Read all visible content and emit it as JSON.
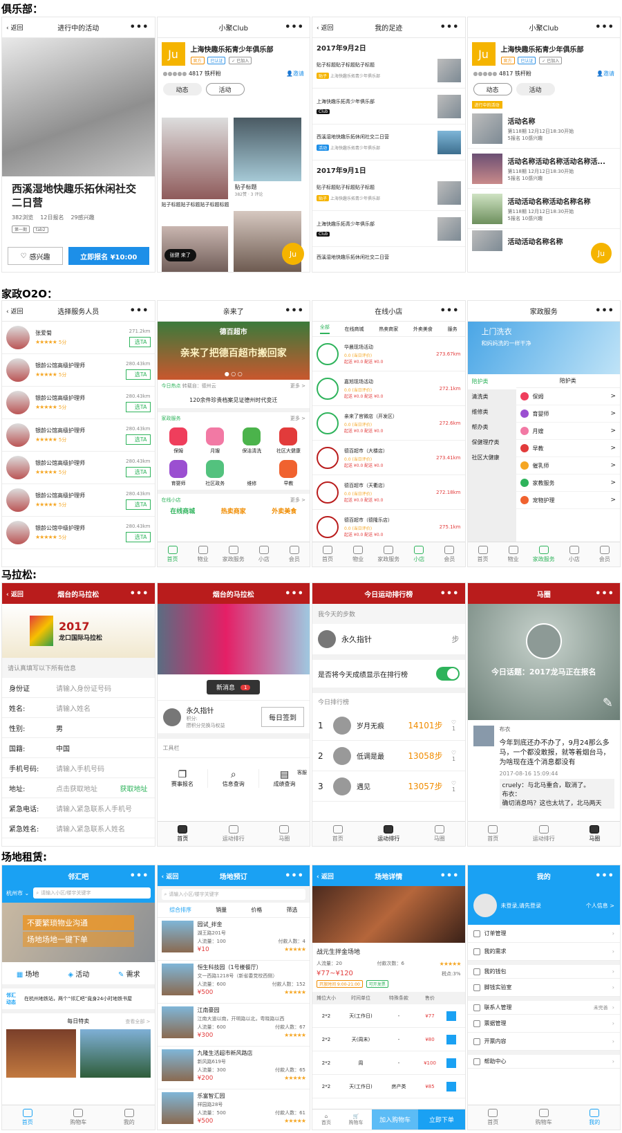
{
  "sections": {
    "club": "俱乐部：",
    "home": "家政O2O：",
    "marathon": "马拉松:",
    "venue": "场地租赁:"
  },
  "club": {
    "s1": {
      "back": "返回",
      "title": "进行中的活动",
      "more": "•••",
      "event_title": "西溪湿地快趣乐拓休闲社交二日营",
      "stats": [
        "382浏览",
        "12日报名",
        "29感兴趣"
      ],
      "tags": [
        "第一期",
        "tab2"
      ],
      "interest": "感兴趣",
      "signup": "立即报名 ¥10:00"
    },
    "s2": {
      "title": "小聚Club",
      "more": "•••",
      "logo": "Ju",
      "club_name": "上海快趣乐拓青少年俱乐部",
      "badges": [
        "官方",
        "已认证",
        "✓ 已加入"
      ],
      "fans": "4817 铁杆粉",
      "invite": "邀请",
      "tabs": [
        "动态",
        "活动"
      ],
      "post_caption": "贴子标题贴子标题贴子标题标题",
      "post2_title": "贴子标题",
      "post2_stats": "382赞 · 3 评论",
      "user": "张健 来了",
      "fab": "Ju"
    },
    "s3": {
      "back": "返回",
      "title": "我的足迹",
      "more": "•••",
      "date1": "2017年9月2日",
      "date2": "2017年9月1日",
      "items": [
        {
          "title": "贴子标题贴子标题贴子标题",
          "badge": "贴子",
          "sub": "上海快趣乐拓青少年俱乐部"
        },
        {
          "title": "上海快趣乐拓青少年俱乐部",
          "badge": "Club",
          "sub": ""
        },
        {
          "title": "西溪湿地快趣乐拓休闲社交二日营",
          "badge": "活动",
          "sub": "上海快趣乐拓青少年俱乐部"
        },
        {
          "title": "贴子标题贴子标题贴子标题",
          "badge": "贴子",
          "sub": "上海快趣乐拓青少年俱乐部"
        },
        {
          "title": "上海快趣乐拓青少年俱乐部",
          "badge": "Club",
          "sub": ""
        },
        {
          "title": "西溪湿地快趣乐拓休闲社交二日营",
          "badge": "",
          "sub": ""
        }
      ]
    },
    "s4": {
      "title": "小聚Club",
      "more": "•••",
      "logo": "Ju",
      "club_name": "上海快趣乐拓青少年俱乐部",
      "badges": [
        "官方",
        "已认证",
        "✓ 已加入"
      ],
      "fans": "4817 铁杆粉",
      "invite": "邀请",
      "tabs": [
        "动态",
        "活动"
      ],
      "section_badge": "进行中的活动",
      "items": [
        {
          "title": "活动名称",
          "line1": "第118期 12月12日18:30开始",
          "line2": "5报名 10感兴趣"
        },
        {
          "title": "活动名称活动名称活动名称活...",
          "line1": "第118期 12月12日18:30开始",
          "line2": "5报名 10感兴趣"
        },
        {
          "title": "活动活动名称活动名称名称",
          "line1": "第118期 12月12日18:30开始",
          "line2": "5报名 10感兴趣"
        },
        {
          "title": "活动活动名称名称",
          "line1": "",
          "line2": ""
        }
      ],
      "fab": "Ju"
    }
  },
  "home": {
    "s1": {
      "back": "返回",
      "title": "选择服务人员",
      "more": "•••",
      "pick": "选TA",
      "stars": "★★★★★",
      "people": [
        {
          "name": "张爱菊",
          "dist": "271.2km",
          "score": "5分"
        },
        {
          "name": "银龄公馆高级护理师",
          "dist": "280.43km",
          "score": "5分"
        },
        {
          "name": "银龄公馆高级护理师",
          "dist": "280.43km",
          "score": "5分"
        },
        {
          "name": "银龄公馆高级护理师",
          "dist": "280.43km",
          "score": "5分"
        },
        {
          "name": "银龄公馆高级护理师",
          "dist": "280.43km",
          "score": "5分"
        },
        {
          "name": "银龄公馆高级护理师",
          "dist": "280.43km",
          "score": "5分"
        },
        {
          "name": "银龄公馆中级护理师",
          "dist": "280.43km",
          "score": "5分"
        }
      ]
    },
    "s2": {
      "title": "亲来了",
      "more": "•••",
      "banner_brand": "德百超市",
      "banner_text": "亲来了把德百超市搬回家",
      "hot_label": "今日热点",
      "hot_sub": "转载自：德州云",
      "more_link": "更多 >",
      "hot_text": "120余件珍贵档案见证德州时代变迁",
      "svc_label": "家政服务",
      "services": [
        "保姆",
        "月嫂",
        "保洁清洗",
        "社区大健康",
        "育婴师",
        "社区政务",
        "维修",
        "早教"
      ],
      "shop_label": "在线小店",
      "shop_row": [
        "在线商城",
        "热卖商家",
        "外卖美食"
      ]
    },
    "s3": {
      "title": "在线小店",
      "more": "•••",
      "tabs": [
        "全部",
        "在线商城",
        "热卖商家",
        "外卖美食",
        "服务"
      ],
      "shops": [
        {
          "name": "华晨现场活动",
          "dist": "273.67km"
        },
        {
          "name": "嘉旭现场活动",
          "dist": "272.1km"
        },
        {
          "name": "亲来了官微店（开发区）",
          "dist": "272.6km"
        },
        {
          "name": "德百超市（大楼店）",
          "dist": "273.41km"
        },
        {
          "name": "德百超市（天衢店）",
          "dist": "272.18km"
        },
        {
          "name": "德百超市（德隆乐店）",
          "dist": "275.1km"
        }
      ],
      "shop_line1": "0.0 (当日评价)",
      "shop_line2": "起送 ¥0.0 配送 ¥0.0"
    },
    "s4": {
      "title": "家政服务",
      "more": "•••",
      "banner1": "上门洗衣",
      "banner2": "和妈妈洗的一样干净",
      "side": [
        "陪护类",
        "清洗类",
        "维修类",
        "帮办类",
        "保健理疗类",
        "社区大健康"
      ],
      "header": "陪护类",
      "items": [
        "保姆",
        "育婴师",
        "月嫂",
        "早教",
        "催乳师",
        "家教服务",
        "宠物护理"
      ]
    },
    "tabs": [
      "首页",
      "物业",
      "家政服务",
      "小店",
      "会员"
    ]
  },
  "marathon": {
    "s1": {
      "back": "返回",
      "title": "烟台的马拉松",
      "more": "•••",
      "banner_year": "2017",
      "banner_name": "龙口国际马拉松",
      "hint": "请认真填写以下所有信息",
      "fields": [
        {
          "label": "身份证",
          "value": "请输入身份证号码"
        },
        {
          "label": "姓名:",
          "value": "请输入姓名"
        },
        {
          "label": "性别:",
          "value": "男"
        },
        {
          "label": "国籍:",
          "value": "中国"
        },
        {
          "label": "手机号码:",
          "value": "请输入手机号码"
        },
        {
          "label": "地址:",
          "value": "点击获取地址"
        },
        {
          "label": "紧急电话:",
          "value": "请输入紧急联系人手机号"
        },
        {
          "label": "紧急姓名:",
          "value": "请输入紧急联系人姓名"
        }
      ],
      "get_addr": "获取地址"
    },
    "s2": {
      "title": "烟台的马拉松",
      "more": "•••",
      "news": "新消息",
      "news_count": "1",
      "user": "永久指针",
      "points": "积分:",
      "points_sub": "攒积分兑换马权益",
      "checkin": "每日签到",
      "tools_label": "工具栏",
      "tools": [
        "赛事报名",
        "信息查询",
        "成绩查询"
      ],
      "service": "客服",
      "tabs": [
        "首页",
        "运动排行",
        "马圈"
      ]
    },
    "s3": {
      "title": "今日运动排行榜",
      "more": "•••",
      "steps_label": "我今天的步数",
      "user": "永久指针",
      "step_unit": "步",
      "toggle_label": "是否将今天成绩显示在排行榜",
      "rank_label": "今日排行榜",
      "ranks": [
        {
          "n": "1",
          "name": "岁月无痕",
          "steps": "14101步",
          "likes": "1"
        },
        {
          "n": "2",
          "name": "低调是最",
          "steps": "13058步",
          "likes": "1"
        },
        {
          "n": "3",
          "name": "遇见",
          "steps": "13057步",
          "likes": "1"
        }
      ],
      "tabs": [
        "首页",
        "运动排行",
        "马圈"
      ]
    },
    "s4": {
      "title": "马圈",
      "more": "•••",
      "topic": "今日话题：2017龙马正在报名",
      "poster": "布衣",
      "post_text": "今年到底还办不办了，9月24那么多马，一个都没敢报，就等着烟台马，为啥现在连个消息都没有",
      "time": "2017-08-16 15:09:44",
      "comment1": "cruely：与北马重合，取消了。",
      "comment2": "布衣：",
      "comment3": "确切消息吗？这也太坑了，北马两天",
      "tabs": [
        "首页",
        "运动排行",
        "马圈"
      ]
    }
  },
  "venue": {
    "s1": {
      "title": "邻汇吧",
      "more": "•••",
      "city": "杭州市",
      "search_ph": "请输入小区/楼宇关键字",
      "banner1": "不要繁琐物业沟通",
      "banner2": "场地场地一键下单",
      "cats": [
        "场地",
        "活动",
        "需求"
      ],
      "news_logo": "邻汇动态",
      "news_text": "在杭州地铁站，两个“邻汇吧”竟身24小时地铁书屋",
      "special": "每日特卖",
      "all": "查看全部 >",
      "tabs": [
        "首页",
        "购物车",
        "我的"
      ]
    },
    "s2": {
      "back": "返回",
      "title": "场地预订",
      "more": "•••",
      "search_ph": "请输入小区/楼宇关键字",
      "filters": [
        "综合排序",
        "销量",
        "价格",
        "筛选"
      ],
      "items": [
        {
          "name": "园试_拌金",
          "addr": "湖王路201号",
          "flow": "人流量：100",
          "paid": "付款人数：4",
          "price": "¥10"
        },
        {
          "name": "恒生科技园（1号楼餐厅）",
          "addr": "文一西路1218号（新省委党校西侧）",
          "flow": "人流量：600",
          "paid": "付款人数：152",
          "price": "¥500"
        },
        {
          "name": "江南豪园",
          "addr": "江南大道以南，开明路以北，粤晓路以西",
          "flow": "人流量：600",
          "paid": "付款人数：67",
          "price": "¥300"
        },
        {
          "name": "九隆生活超市新风路店",
          "addr": "新风路619号",
          "flow": "人流量：300",
          "paid": "付款人数：65",
          "price": "¥200"
        },
        {
          "name": "乐富智汇园",
          "addr": "祥园路28号",
          "flow": "人流量：500",
          "paid": "付款人数：61",
          "price": "¥500"
        }
      ]
    },
    "s3": {
      "back": "返回",
      "title": "场地详情",
      "more": "•••",
      "name": "战元生拌金场地",
      "flow": "人流量：20",
      "paid": "付款次数：6",
      "price": "¥77~¥120",
      "tax": "税点:3%",
      "tags": [
        "开放时间 9:00-21:00",
        "可开发票"
      ],
      "head": [
        "摊位大小",
        "时间单位",
        "特殊条款",
        "售价"
      ],
      "rows": [
        {
          "size": "2*2",
          "unit": "天(工作日)",
          "term": "-",
          "price": "¥77"
        },
        {
          "size": "2*2",
          "unit": "天(周末)",
          "term": "-",
          "price": "¥80"
        },
        {
          "size": "2*2",
          "unit": "周",
          "term": "-",
          "price": "¥100"
        },
        {
          "size": "2*2",
          "unit": "天(工作日)",
          "term": "房产类",
          "price": "¥85"
        }
      ],
      "home": "首页",
      "cart": "购物车",
      "add_cart": "加入购物车",
      "buy": "立即下单"
    },
    "s4": {
      "title": "我的",
      "more": "•••",
      "login": "未登录,请先登录",
      "profile": "个人信息 >",
      "menu": [
        "订单管理",
        "我的需求",
        "我的钱包",
        "脚钱实验室",
        "联系人管理",
        "票据管理",
        "开票内容",
        "帮助中心"
      ],
      "unset": "未完善",
      "tabs": [
        "首页",
        "购物车",
        "我的"
      ]
    }
  }
}
